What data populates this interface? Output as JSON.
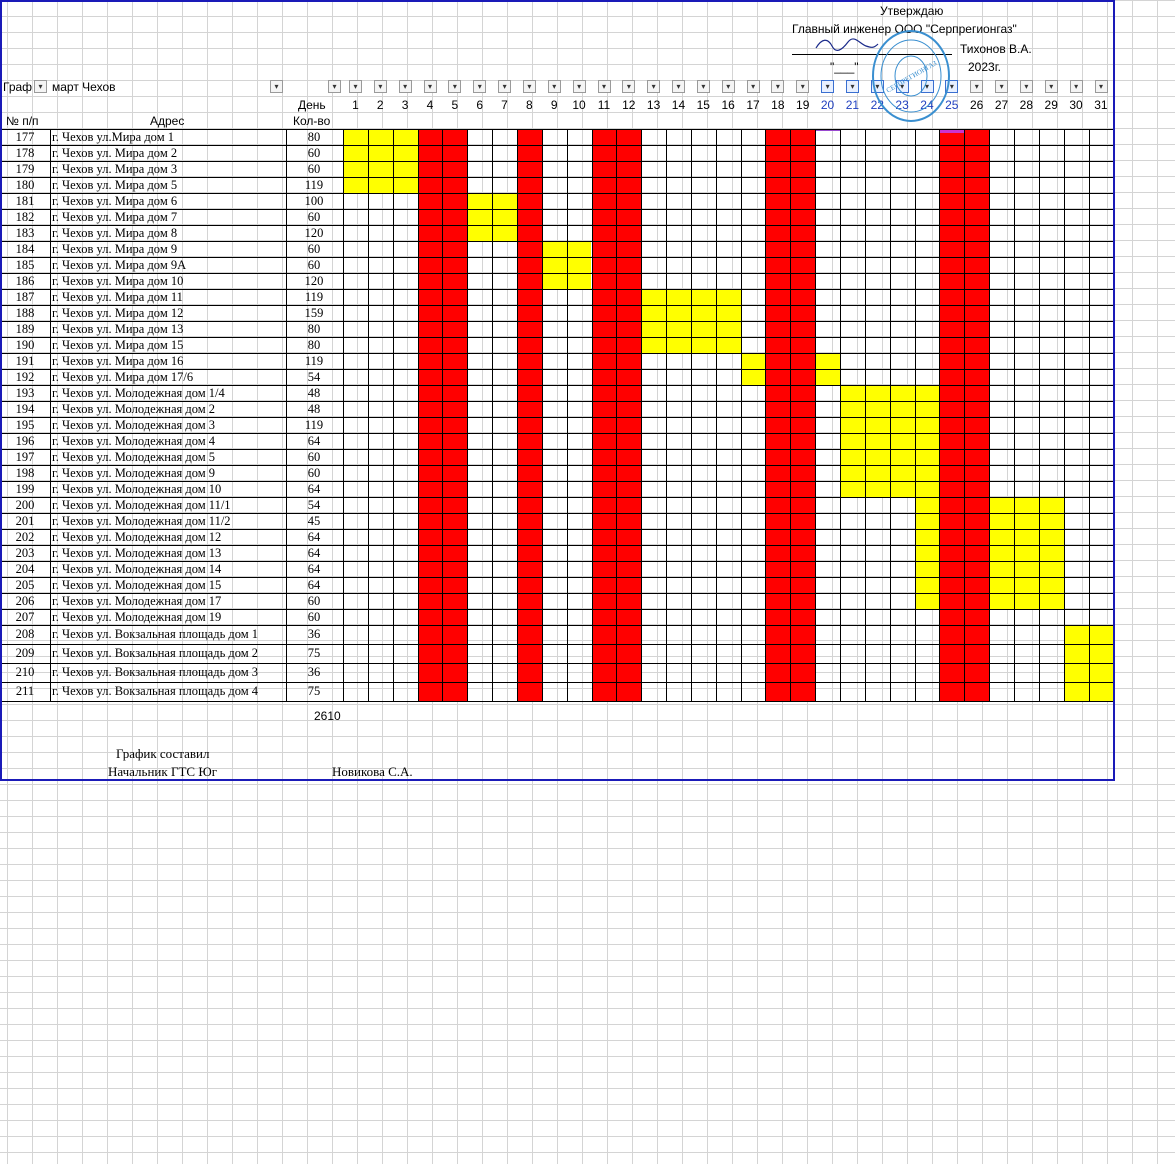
{
  "approval": {
    "title": "Утверждаю",
    "position": "Главный инженер ООО \"Серпрегионгаз\"",
    "signer": "Тихонов В.А.",
    "date_day": "\"___\"",
    "year": "2023г."
  },
  "filter_row": {
    "label": "Граф",
    "title": "март Чехов"
  },
  "headers": {
    "num": "№ п/п",
    "address": "Адрес",
    "day": "День",
    "qty": "Кол-во"
  },
  "days": [
    1,
    2,
    3,
    4,
    5,
    6,
    7,
    8,
    9,
    10,
    11,
    12,
    13,
    14,
    15,
    16,
    17,
    18,
    19,
    20,
    21,
    22,
    23,
    24,
    25,
    26,
    27,
    28,
    29,
    30,
    31
  ],
  "filtered_days": [
    20,
    21,
    22,
    23,
    24,
    25
  ],
  "rows": [
    {
      "n": "177",
      "address": "г. Чехов ул.Мира дом 1",
      "qty": "80"
    },
    {
      "n": "178",
      "address": "г. Чехов ул. Мира дом 2",
      "qty": "60"
    },
    {
      "n": "179",
      "address": "г. Чехов ул. Мира дом 3",
      "qty": "60"
    },
    {
      "n": "180",
      "address": "г. Чехов ул. Мира дом 5",
      "qty": "119"
    },
    {
      "n": "181",
      "address": "г. Чехов ул. Мира дом 6",
      "qty": "100"
    },
    {
      "n": "182",
      "address": "г. Чехов ул. Мира дом 7",
      "qty": "60"
    },
    {
      "n": "183",
      "address": "г. Чехов ул. Мира дом 8",
      "qty": "120"
    },
    {
      "n": "184",
      "address": "г. Чехов ул. Мира дом 9",
      "qty": "60"
    },
    {
      "n": "185",
      "address": "г. Чехов ул. Мира дом 9А",
      "qty": "60"
    },
    {
      "n": "186",
      "address": "г. Чехов ул. Мира дом 10",
      "qty": "120"
    },
    {
      "n": "187",
      "address": "г. Чехов ул. Мира дом 11",
      "qty": "119"
    },
    {
      "n": "188",
      "address": "г. Чехов ул. Мира дом 12",
      "qty": "159"
    },
    {
      "n": "189",
      "address": "г. Чехов ул. Мира дом 13",
      "qty": "80"
    },
    {
      "n": "190",
      "address": "г. Чехов ул. Мира дом 15",
      "qty": "80"
    },
    {
      "n": "191",
      "address": "г. Чехов ул. Мира дом 16",
      "qty": "119"
    },
    {
      "n": "192",
      "address": "г. Чехов ул. Мира дом 17/6",
      "qty": "54"
    },
    {
      "n": "193",
      "address": "г. Чехов ул. Молодежная дом 1/4",
      "qty": "48"
    },
    {
      "n": "194",
      "address": "г. Чехов ул. Молодежная дом 2",
      "qty": "48"
    },
    {
      "n": "195",
      "address": "г. Чехов ул. Молодежная дом 3",
      "qty": "119"
    },
    {
      "n": "196",
      "address": "г. Чехов ул. Молодежная дом 4",
      "qty": "64"
    },
    {
      "n": "197",
      "address": "г. Чехов ул. Молодежная дом 5",
      "qty": "60"
    },
    {
      "n": "198",
      "address": "г. Чехов ул. Молодежная дом 9",
      "qty": "60"
    },
    {
      "n": "199",
      "address": "г. Чехов ул. Молодежная дом 10",
      "qty": "64"
    },
    {
      "n": "200",
      "address": "г. Чехов ул. Молодежная дом 11/1",
      "qty": "54"
    },
    {
      "n": "201",
      "address": "г. Чехов ул. Молодежная дом 11/2",
      "qty": "45"
    },
    {
      "n": "202",
      "address": "г. Чехов ул. Молодежная дом 12",
      "qty": "64"
    },
    {
      "n": "203",
      "address": "г. Чехов ул. Молодежная дом 13",
      "qty": "64"
    },
    {
      "n": "204",
      "address": "г. Чехов ул. Молодежная дом 14",
      "qty": "64"
    },
    {
      "n": "205",
      "address": "г. Чехов ул. Молодежная дом 15",
      "qty": "64"
    },
    {
      "n": "206",
      "address": "г. Чехов ул. Молодежная дом 17",
      "qty": "60"
    },
    {
      "n": "207",
      "address": "г. Чехов ул. Молодежная дом 19",
      "qty": "60"
    },
    {
      "n": "208",
      "address": "г. Чехов ул. Вокзальная площадь дом 1",
      "qty": "36"
    },
    {
      "n": "209",
      "address": "г. Чехов ул. Вокзальная площадь дом 2",
      "qty": "75"
    },
    {
      "n": "210",
      "address": "г. Чехов ул. Вокзальная площадь дом 3",
      "qty": "36"
    },
    {
      "n": "211",
      "address": "г. Чехов ул. Вокзальная площадь дом 4",
      "qty": "75"
    }
  ],
  "holiday_days": [
    4,
    5,
    8,
    11,
    12,
    18,
    19,
    25,
    26
  ],
  "work_blocks": [
    {
      "rows": [
        0,
        3
      ],
      "days": [
        1,
        3
      ]
    },
    {
      "rows": [
        4,
        6
      ],
      "days": [
        6,
        7
      ]
    },
    {
      "rows": [
        7,
        9
      ],
      "days": [
        9,
        10
      ]
    },
    {
      "rows": [
        10,
        13
      ],
      "days": [
        13,
        16
      ]
    },
    {
      "rows": [
        14,
        15
      ],
      "days": [
        17,
        17
      ]
    },
    {
      "rows": [
        14,
        15
      ],
      "days": [
        20,
        20
      ]
    },
    {
      "rows": [
        16,
        22
      ],
      "days": [
        21,
        24
      ]
    },
    {
      "rows": [
        23,
        29
      ],
      "days": [
        24,
        24
      ]
    },
    {
      "rows": [
        23,
        29
      ],
      "days": [
        27,
        29
      ]
    },
    {
      "rows": [
        31,
        34
      ],
      "days": [
        30,
        31
      ]
    }
  ],
  "colors": {
    "holiday": "#ff0000",
    "work": "#ffff00",
    "frame": "#1a1ab8",
    "stamp": "#3a8fd0",
    "magenta_marker": "#cc33cc"
  },
  "total": "2610",
  "footer": {
    "composed": "График составил",
    "role": "Начальник ГТС Юг",
    "name": "Новикова С.А."
  },
  "stamp": {
    "text": "СЕРПРЕГИОНГАЗ"
  }
}
